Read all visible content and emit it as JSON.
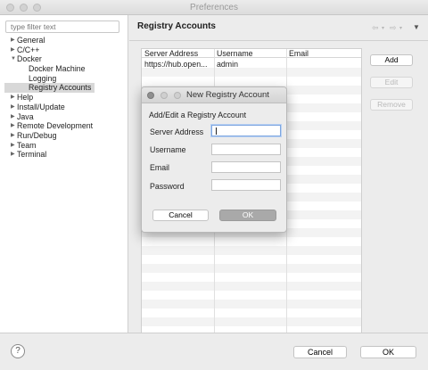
{
  "window": {
    "title": "Preferences"
  },
  "sidebar": {
    "filter_placeholder": "type filter text",
    "items": [
      {
        "label": "General",
        "arrow": "▶"
      },
      {
        "label": "C/C++",
        "arrow": "▶"
      },
      {
        "label": "Docker",
        "arrow": "▼"
      },
      {
        "label": "Docker Machine"
      },
      {
        "label": "Logging"
      },
      {
        "label": "Registry Accounts"
      },
      {
        "label": "Help",
        "arrow": "▶"
      },
      {
        "label": "Install/Update",
        "arrow": "▶"
      },
      {
        "label": "Java",
        "arrow": "▶"
      },
      {
        "label": "Remote Development",
        "arrow": "▶"
      },
      {
        "label": "Run/Debug",
        "arrow": "▶"
      },
      {
        "label": "Team",
        "arrow": "▶"
      },
      {
        "label": "Terminal",
        "arrow": "▶"
      }
    ]
  },
  "main": {
    "title": "Registry Accounts",
    "nav": {
      "back": "⇦",
      "forward": "⇨",
      "caret": "▾",
      "menu": "▼"
    },
    "table": {
      "columns": [
        "Server Address",
        "Username",
        "Email"
      ],
      "rows": [
        [
          "https://hub.open...",
          "admin",
          ""
        ]
      ]
    },
    "buttons": {
      "add": "Add",
      "edit": "Edit",
      "remove": "Remove"
    }
  },
  "footer": {
    "help": "?",
    "cancel": "Cancel",
    "ok": "OK"
  },
  "dialog": {
    "title": "New Registry Account",
    "heading": "Add/Edit a Registry Account",
    "fields": {
      "server_address": {
        "label": "Server Address",
        "value": ""
      },
      "username": {
        "label": "Username",
        "value": ""
      },
      "email": {
        "label": "Email",
        "value": ""
      },
      "password": {
        "label": "Password",
        "value": ""
      }
    },
    "cancel": "Cancel",
    "ok": "OK"
  }
}
